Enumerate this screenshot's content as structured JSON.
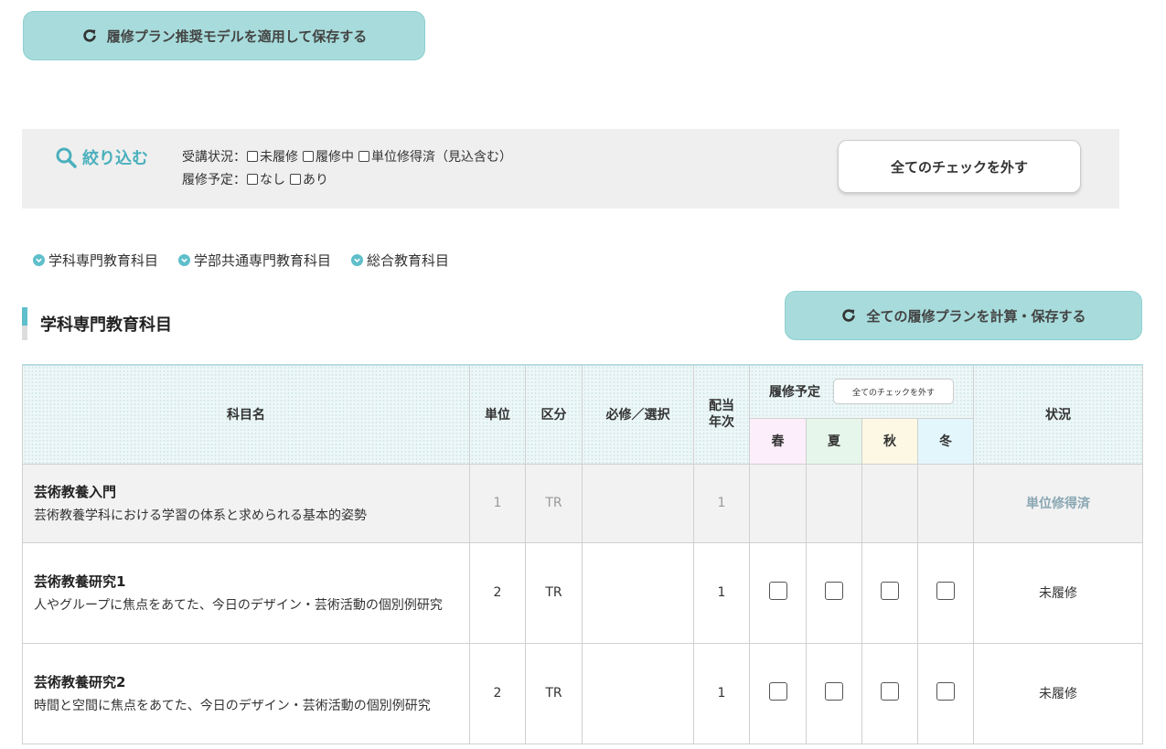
{
  "top_button": {
    "label": "履修プラン推奨モデルを適用して保存する"
  },
  "filter": {
    "title": "絞り込む",
    "status_label": "受講状況：",
    "status_options": [
      "未履修",
      "履修中",
      "単位修得済（見込含む）"
    ],
    "plan_label": "履修予定：",
    "plan_options": [
      "なし",
      "あり"
    ],
    "uncheck_all": "全てのチェックを外す"
  },
  "categories": [
    "学科専門教育科目",
    "学部共通専門教育科目",
    "総合教育科目"
  ],
  "section": {
    "title": "学科専門教育科目",
    "calc_button": "全ての履修プランを計算・保存する"
  },
  "table": {
    "headers": {
      "name": "科目名",
      "credits": "単位",
      "type": "区分",
      "required": "必修／選択",
      "year": "配当年次",
      "plan": "履修予定",
      "plan_uncheck": "全てのチェックを外す",
      "status": "状況"
    },
    "seasons": [
      "春",
      "夏",
      "秋",
      "冬"
    ],
    "rows": [
      {
        "name": "芸術教養入門",
        "desc": "芸術教養学科における学習の体系と求められる基本的姿勢",
        "credits": "1",
        "type": "TR",
        "required": "",
        "year": "1",
        "status": "単位修得済",
        "done": true
      },
      {
        "name": "芸術教養研究1",
        "desc": "人やグループに焦点をあてた、今日のデザイン・芸術活動の個別例研究",
        "credits": "2",
        "type": "TR",
        "required": "",
        "year": "1",
        "status": "未履修",
        "done": false
      },
      {
        "name": "芸術教養研究2",
        "desc": "時間と空間に焦点をあてた、今日のデザイン・芸術活動の個別例研究",
        "credits": "2",
        "type": "TR",
        "required": "",
        "year": "1",
        "status": "未履修",
        "done": false
      }
    ]
  },
  "colors": {
    "accent": "#5fbfcb",
    "button_bg": "#a8dcdc",
    "panel_bg": "#efefef"
  }
}
